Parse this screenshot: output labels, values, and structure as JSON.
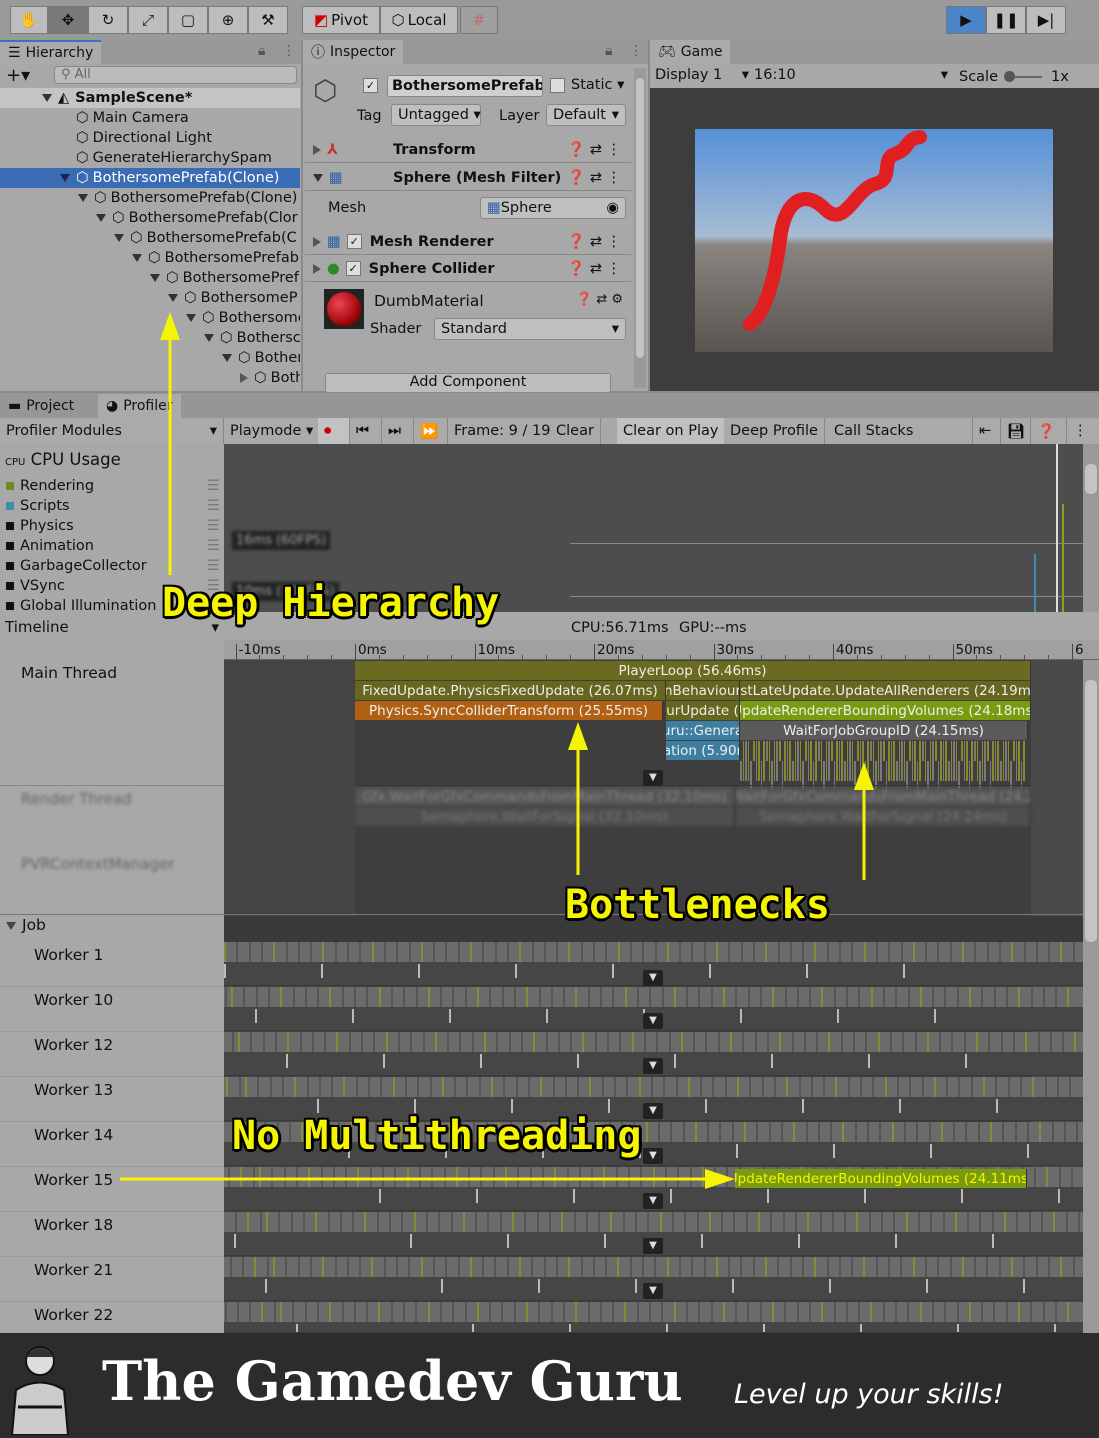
{
  "toolbar": {
    "tools": [
      "hand-tool",
      "move-tool",
      "rotate-tool",
      "scale-tool",
      "rect-tool",
      "transform-tool",
      "custom-tool"
    ],
    "pivot": "Pivot",
    "local": "Local"
  },
  "hierarchy": {
    "title": "Hierarchy",
    "search_placeholder": "All",
    "scene": "SampleScene*",
    "items": [
      "Main Camera",
      "Directional Light",
      "GenerateHierarchySpam",
      "BothersomePrefab(Clone)",
      "BothersomePrefab(Clone)",
      "BothersomePrefab(Clor",
      "BothersomePrefab(C",
      "BothersomePrefab",
      "BothersomePref",
      "BothersomeP",
      "Bothersome",
      "Bothersc",
      "Bother",
      "Both"
    ]
  },
  "inspector": {
    "title": "Inspector",
    "object_name": "BothersomePrefab(C",
    "static": "Static",
    "tag_label": "Tag",
    "tag": "Untagged",
    "layer_label": "Layer",
    "layer": "Default",
    "components": [
      "Transform",
      "Sphere (Mesh Filter)",
      "Mesh Renderer",
      "Sphere Collider"
    ],
    "mesh_label": "Mesh",
    "mesh": "Sphere",
    "material": "DumbMaterial",
    "shader_label": "Shader",
    "shader": "Standard",
    "add_component": "Add Component"
  },
  "game": {
    "title": "Game",
    "display": "Display 1",
    "aspect": "16:10",
    "scale_label": "Scale",
    "scale": "1x"
  },
  "profiler": {
    "tabs": [
      "Project",
      "Profiler"
    ],
    "modules_label": "Profiler Modules",
    "playmode": "Playmode",
    "frame": "Frame: 9 / 19",
    "clear": "Clear",
    "clear_on_play": "Clear on Play",
    "deep_profile": "Deep Profile",
    "call_stacks": "Call Stacks",
    "cpu_usage": "CPU Usage",
    "legend": [
      {
        "name": "Rendering",
        "color": "#6f8f1a"
      },
      {
        "name": "Scripts",
        "color": "#3f8fb0"
      },
      {
        "name": "Physics",
        "color": "#111111"
      },
      {
        "name": "Animation",
        "color": "#111111"
      },
      {
        "name": "GarbageCollector",
        "color": "#111111"
      },
      {
        "name": "VSync",
        "color": "#111111"
      },
      {
        "name": "Global Illumination",
        "color": "#111111"
      }
    ],
    "graph_labels": [
      "16ms (60FPS)",
      "10ms (100FPS)"
    ],
    "view": "Timeline",
    "cpu": "CPU:56.71ms",
    "gpu": "GPU:--ms",
    "ticks": [
      "-10ms",
      "0ms",
      "10ms",
      "20ms",
      "30ms",
      "40ms",
      "50ms",
      "6"
    ],
    "main_thread": "Main Thread",
    "render_thread": "Render Thread",
    "pvr": "PVRContextManager",
    "render_bars": [
      "Gfx.WaitForGfxCommandsFromMainThread (32.10ms)",
      "WaitForGfxCommandsFromMainThread (24.2",
      "Semaphore.WaitForSignal (32.10ms)",
      "Semaphore.WaitForSignal (24.24ms)"
    ],
    "bars": {
      "playerloop": "PlayerLoop (56.46ms)",
      "fixed": "FixedUpdate.PhysicsFixedUpdate (26.07ms)",
      "behaviour": "nBehaviour",
      "postlate": "ostLateUpdate.UpdateAllRenderers (24.19ms",
      "physics": "Physics.SyncColliderTransform (25.55ms)",
      "urupdate": "urUpdate (",
      "bounding": "UpdateRendererBoundingVolumes (24.18ms)",
      "genera": "uru::Genera",
      "wait": "WaitForJobGroupID (24.15ms)",
      "ation": "ation (5.90r"
    },
    "job": "Job",
    "workers": [
      "Worker 1",
      "Worker 10",
      "Worker 12",
      "Worker 13",
      "Worker 14",
      "Worker 15",
      "Worker 18",
      "Worker 21",
      "Worker 22"
    ],
    "worker15_bar": "UpdateRendererBoundingVolumes (24.11ms)"
  },
  "annotations": {
    "deep": "Deep Hierarchy",
    "bottlenecks": "Bottlenecks",
    "multithreading": "No Multithreading",
    "color": "#f5f500"
  },
  "footer": {
    "brand": "The Gamedev Guru",
    "tagline": "Level up your skills!"
  }
}
